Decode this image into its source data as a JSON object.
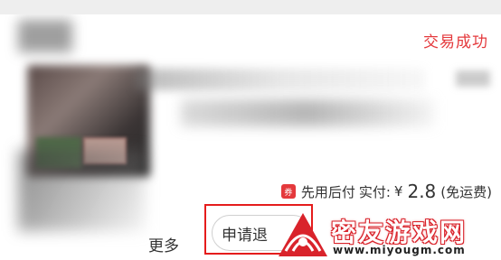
{
  "order": {
    "status": "交易成功",
    "coupon_glyph": "券",
    "pay_method": "先用后付",
    "paid_label": "实付:",
    "currency": "¥",
    "paid_amount": "2.8",
    "shipping_note": "(免运费)"
  },
  "actions": {
    "more_label": "更多",
    "refund_label": "申请退"
  },
  "watermark": {
    "name": "密友游戏网",
    "url": "www.miyougm.com"
  },
  "colors": {
    "accent": "#e4393c",
    "highlight_border": "#e51c1c"
  }
}
